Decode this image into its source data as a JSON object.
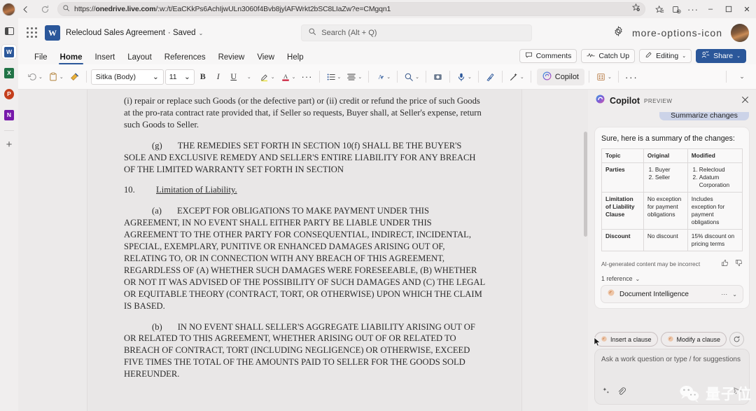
{
  "browser": {
    "url": "https://onedrive.live.com/:w:/t/EaCKkPs6AchIjwULn3060f4Bvb8jylAFWrkt2bSC8LIaZw?e=CMgqn1",
    "url_bold": "onedrive.live.com",
    "back_icon": "back-arrow-icon",
    "reload_icon": "reload-icon",
    "search_icon": "search-icon",
    "favorite_icon": "add-favorite-icon",
    "favorites_icon": "favorites-icon",
    "collections_icon": "collections-icon",
    "settings_more_icon": "more-options-icon",
    "minimize": "–",
    "maximize": "▢",
    "close": "✕"
  },
  "rail": {
    "items": [
      {
        "name": "split-screen-icon",
        "label": ""
      },
      {
        "name": "word-app-icon",
        "label": "W",
        "color": "#2b579a"
      },
      {
        "name": "excel-app-icon",
        "label": "X",
        "color": "#217346"
      },
      {
        "name": "powerpoint-app-icon",
        "label": "P",
        "color": "#c43e1c"
      },
      {
        "name": "onenote-app-icon",
        "label": "N",
        "color": "#7719aa"
      }
    ],
    "add_label": "+"
  },
  "office_header": {
    "app_launcher_icon": "waffle-icon",
    "app_icon_letter": "W",
    "document_title": "Relecloud Sales Agreement",
    "save_state": "· Saved",
    "title_chevron": "⌄",
    "search_placeholder": "Search (Alt + Q)",
    "settings_icon": "gear-icon",
    "more_icon": "more-options-icon",
    "avatar": "user-avatar"
  },
  "ribbon": {
    "tabs": [
      {
        "label": "File",
        "active": false
      },
      {
        "label": "Home",
        "active": true
      },
      {
        "label": "Insert",
        "active": false
      },
      {
        "label": "Layout",
        "active": false
      },
      {
        "label": "References",
        "active": false
      },
      {
        "label": "Review",
        "active": false
      },
      {
        "label": "View",
        "active": false
      },
      {
        "label": "Help",
        "active": false
      }
    ],
    "right_buttons": [
      {
        "label": "Comments",
        "icon": "comment-icon",
        "style": "light"
      },
      {
        "label": "Catch Up",
        "icon": "catch-up-icon",
        "style": "light"
      },
      {
        "label": "Editing",
        "icon": "pencil-icon",
        "style": "light",
        "chevron": "⌄"
      },
      {
        "label": "Share",
        "icon": "share-person-icon",
        "style": "primary",
        "chevron": "⌄"
      }
    ],
    "toolbar": {
      "undo_icon": "undo-icon",
      "paste_icon": "paste-icon",
      "format_painter_icon": "format-painter-icon",
      "font_name": "Sitka (Body)",
      "font_size": "11",
      "bold": "B",
      "italic": "I",
      "underline": "U",
      "highlight_icon": "text-highlight-icon",
      "font_color_icon": "font-color-icon",
      "more_font_icon": "more-font-options-icon",
      "bullets_icon": "bullet-list-icon",
      "align_icon": "align-icon",
      "styles_icon": "styles-icon",
      "find_icon": "find-icon",
      "screenshot_icon": "screenshot-icon",
      "dictate_icon": "microphone-icon",
      "editor_icon": "editor-icon",
      "designer_icon": "designer-wand-icon",
      "copilot_label": "Copilot",
      "copilot_icon": "copilot-icon",
      "addins_icon": "add-ins-icon",
      "overflow_icon": "more-commands-icon",
      "collapse_icon": "collapse-ribbon-icon",
      "chevron": "⌄"
    }
  },
  "document": {
    "paragraphs": [
      {
        "type": "plain",
        "text": "(i) repair or replace such Goods (or the defective part) or (ii) credit or refund the price of such Goods at the pro-rata contract rate provided that, if Seller so requests, Buyer shall, at Seller's expense, return such Goods to Seller."
      },
      {
        "type": "indent",
        "marker": "(g)",
        "text": "THE REMEDIES SET FORTH IN SECTION 10(f) SHALL BE THE BUYER'S SOLE AND EXCLUSIVE REMEDY AND SELLER'S ENTIRE LIABILITY FOR ANY BREACH OF THE LIMITED WARRANTY SET FORTH IN SECTION"
      },
      {
        "type": "heading",
        "number": "10.",
        "text": "Limitation of Liability."
      },
      {
        "type": "indent",
        "marker": "(a)",
        "text": "EXCEPT FOR OBLIGATIONS TO MAKE PAYMENT UNDER THIS AGREEMENT, IN NO EVENT SHALL EITHER PARTY BE LIABLE UNDER THIS AGREEMENT TO THE OTHER PARTY FOR CONSEQUENTIAL, INDIRECT, INCIDENTAL, SPECIAL, EXEMPLARY, PUNITIVE OR ENHANCED DAMAGES ARISING OUT OF, RELATING TO, OR IN CONNECTION WITH ANY BREACH OF THIS AGREEMENT, REGARDLESS OF (A) WHETHER SUCH DAMAGES WERE FORESEEABLE, (B) WHETHER OR NOT IT WAS ADVISED OF THE POSSIBILITY OF SUCH DAMAGES AND (C) THE LEGAL OR EQUITABLE THEORY (CONTRACT, TORT, OR OTHERWISE) UPON WHICH THE CLAIM IS BASED."
      },
      {
        "type": "indent",
        "marker": "(b)",
        "text": "IN NO EVENT SHALL SELLER'S AGGREGATE LIABILITY ARISING OUT OF OR RELATED TO THIS AGREEMENT, WHETHER ARISING OUT OF OR RELATED TO BREACH OF CONTRACT, TORT (INCLUDING NEGLIGENCE) OR OTHERWISE, EXCEED FIVE TIMES THE TOTAL OF THE AMOUNTS PAID TO SELLER FOR THE GOODS SOLD HEREUNDER."
      }
    ]
  },
  "copilot": {
    "title": "Copilot",
    "badge": "PREVIEW",
    "close_icon": "close-icon",
    "user_message": "Summarize changes",
    "response_lead": "Sure, here is a summary of the changes:",
    "table": {
      "headers": [
        "Topic",
        "Original",
        "Modified"
      ],
      "rows": [
        {
          "topic": "Parties",
          "original_list": [
            "Buyer",
            "Seller"
          ],
          "modified_list": [
            "Relecloud",
            "Adatum Corporation"
          ]
        },
        {
          "topic": "Limitation of Liability Clause",
          "original": "No exception for payment obligations",
          "modified": "Includes exception for payment obligations"
        },
        {
          "topic": "Discount",
          "original": "No discount",
          "modified": "15% discount on pricing terms"
        }
      ]
    },
    "disclaimer": "AI-generated content may be incorrect",
    "thumbs_up_icon": "thumbs-up-icon",
    "thumbs_down_icon": "thumbs-down-icon",
    "references_label": "1 reference",
    "references_chevron": "⌄",
    "reference_item": "Document Intelligence",
    "reference_more": "···",
    "reference_chevron": "⌄",
    "actions": [
      {
        "label": "Insert a clause",
        "icon": "copilot-sparkle-icon"
      },
      {
        "label": "Modify a clause",
        "icon": "copilot-sparkle-icon"
      }
    ],
    "refresh_icon": "refresh-icon",
    "input_placeholder": "Ask a work question or type / for suggestions",
    "prompt_icon": "prompt-sparkle-icon",
    "attach_icon": "attachment-icon",
    "send_icon": "send-icon"
  },
  "watermark": {
    "text": "量子位",
    "logo": "wechat-icon"
  },
  "colors": {
    "accent": "#2b579a",
    "user_bubble": "#ccd3e8",
    "panel_bg": "#efeded",
    "page_bg": "#e9e7e7"
  }
}
